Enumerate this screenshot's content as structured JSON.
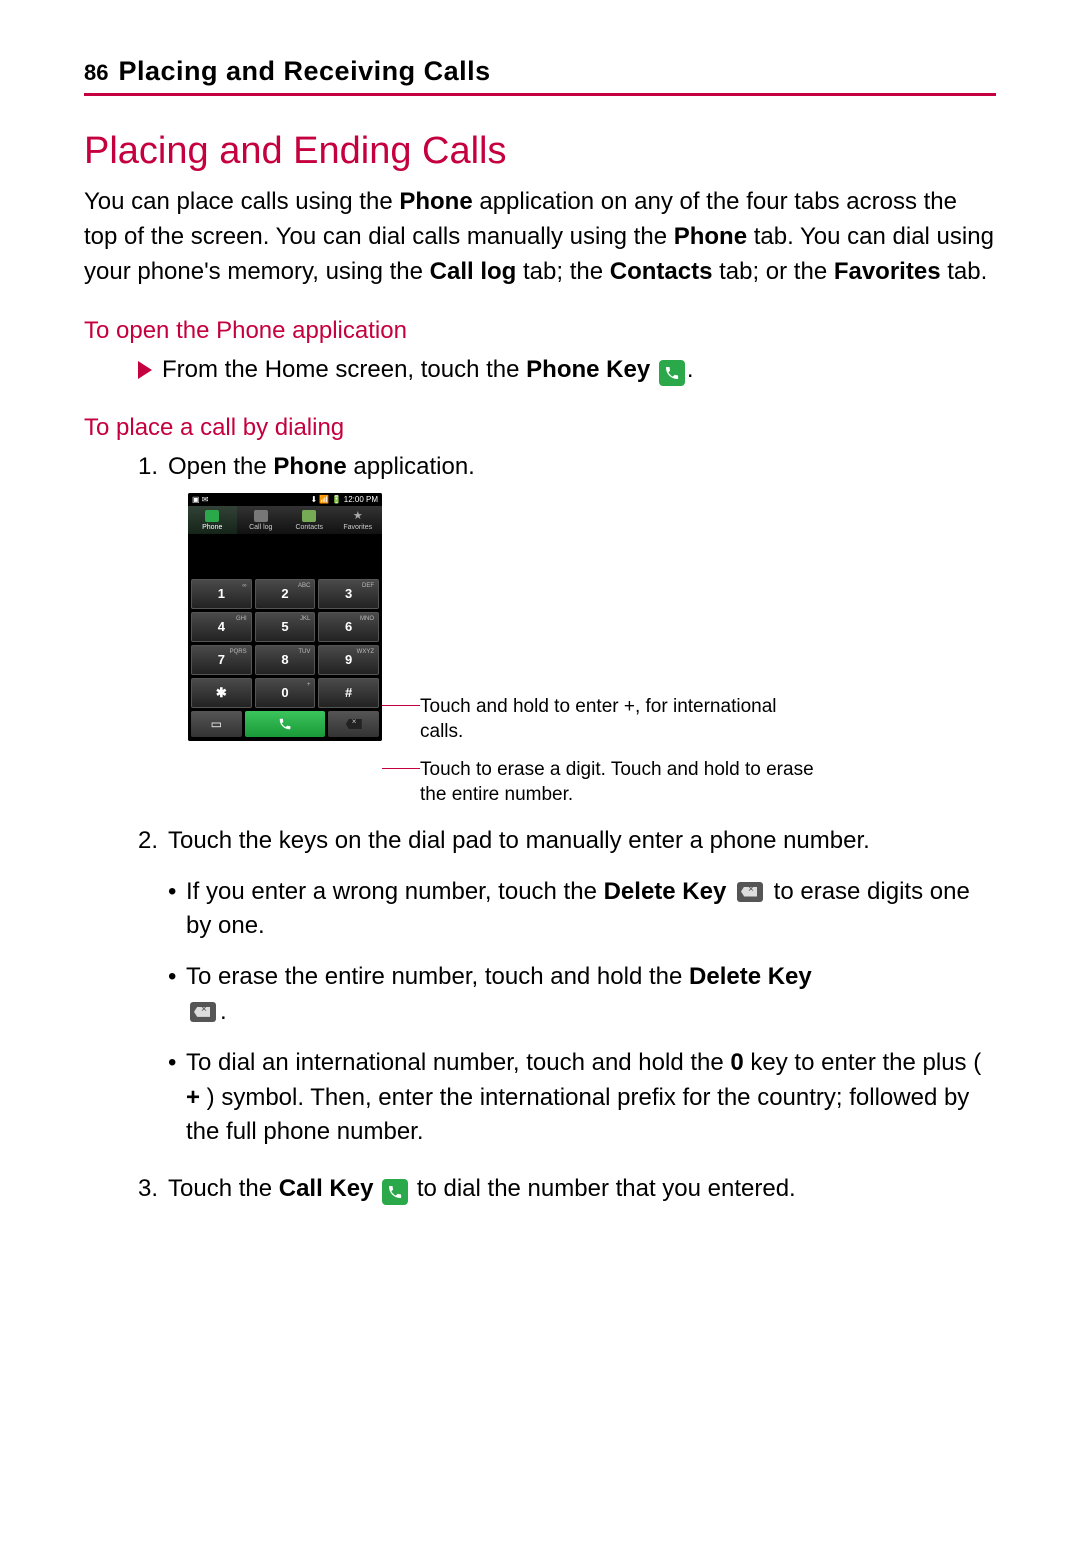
{
  "header": {
    "page_number": "86",
    "chapter_title": "Placing and Receiving Calls"
  },
  "section_title": "Placing and Ending Calls",
  "intro": {
    "p1a": "You can place calls using the ",
    "p1b": "Phone",
    "p1c": " application on any of the four tabs across the top of the screen. You can dial calls manually using the ",
    "p1d": "Phone",
    "p1e": " tab. You can dial using your phone's memory, using the ",
    "p1f": "Call log",
    "p1g": " tab; the ",
    "p1h": "Contacts",
    "p1i": " tab; or the ",
    "p1j": "Favorites",
    "p1k": " tab."
  },
  "sub1": {
    "title": "To open the Phone application",
    "line_a": "From the Home screen, touch the ",
    "line_b": "Phone Key",
    "line_c": "."
  },
  "sub2": {
    "title": "To place a call by dialing",
    "step1_num": "1.",
    "step1_a": "Open the ",
    "step1_b": "Phone",
    "step1_c": " application."
  },
  "phone": {
    "status_left": "▣ ✉",
    "status_right": "⬇ 📶 🔋 12:00 PM",
    "tabs": {
      "phone": "Phone",
      "calllog": "Call log",
      "contacts": "Contacts",
      "favorites": "Favorites"
    },
    "keys": {
      "k1": "1",
      "k1s": "∞",
      "k2": "2",
      "k2s": "ABC",
      "k3": "3",
      "k3s": "DEF",
      "k4": "4",
      "k4s": "GHI",
      "k5": "5",
      "k5s": "JKL",
      "k6": "6",
      "k6s": "MNO",
      "k7": "7",
      "k7s": "PQRS",
      "k8": "8",
      "k8s": "TUV",
      "k9": "9",
      "k9s": "WXYZ",
      "kstar": "✱",
      "k0": "0",
      "k0s": "+",
      "khash": "#"
    },
    "callout1": "Touch and hold to enter +, for international calls.",
    "callout2": "Touch to erase a digit. Touch and hold to erase the entire number."
  },
  "steps": {
    "step2_num": "2.",
    "step2_text": "Touch the keys on the dial pad to manually enter a phone number.",
    "b1_a": "If you enter a wrong number, touch the ",
    "b1_b": "Delete Key",
    "b1_c": " to erase digits one by one.",
    "b2_a": "To erase the entire number, touch and hold the ",
    "b2_b": "Delete Key",
    "b2_c": ".",
    "b3_a": "To dial an international number, touch and hold the ",
    "b3_b": "0",
    "b3_c": " key to enter the plus ( ",
    "b3_d": "+",
    "b3_e": " ) symbol. Then, enter the international prefix for the country; followed by the full phone number.",
    "step3_num": "3.",
    "step3_a": "Touch the ",
    "step3_b": "Call Key",
    "step3_c": " to dial the number that you entered."
  }
}
